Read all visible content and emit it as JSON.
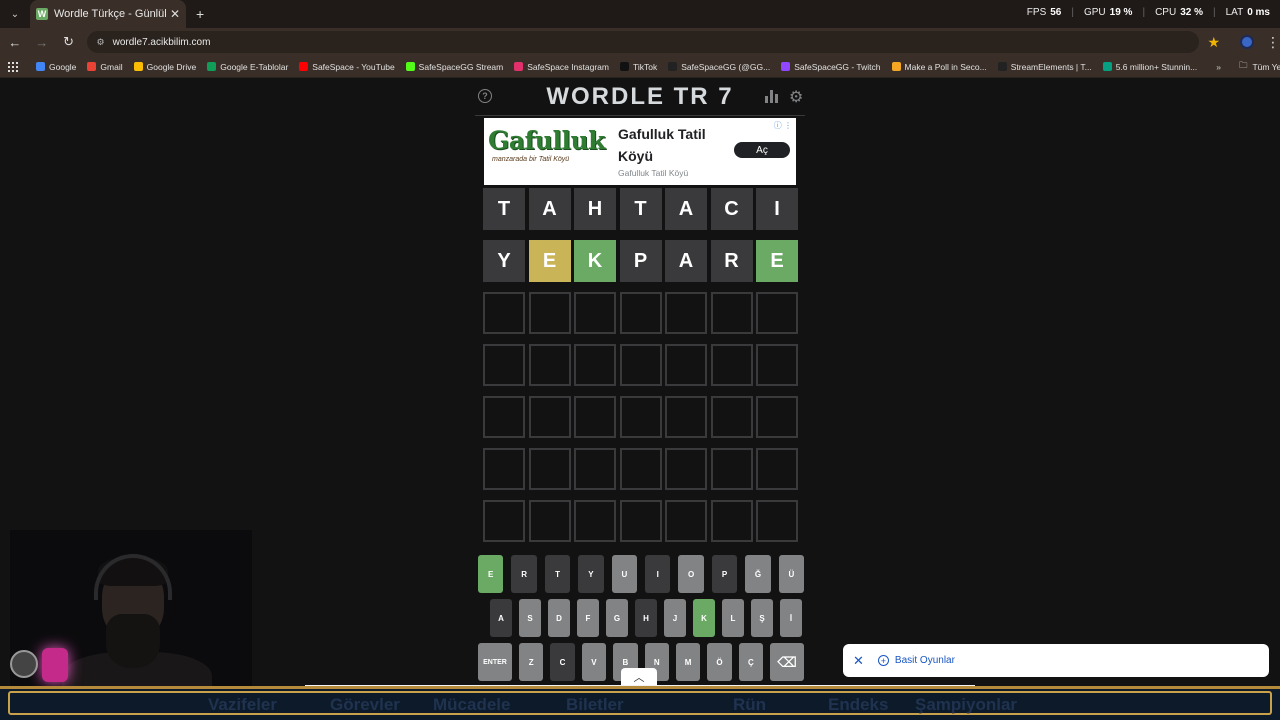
{
  "browser": {
    "tab_title": "Wordle Türkçe - Günlük Kelime",
    "tab_favicon": "W",
    "url": "wordle7.acikbilim.com",
    "overlay": {
      "fps_label": "FPS",
      "fps_value": "56",
      "gpu_label": "GPU",
      "gpu_value": "19 %",
      "cpu_label": "CPU",
      "cpu_value": "32 %",
      "lat_label": "LAT",
      "lat_value": "0 ms"
    },
    "bookmarks": [
      {
        "label": "Google",
        "color": "#4285f4"
      },
      {
        "label": "Gmail",
        "color": "#ea4335"
      },
      {
        "label": "Google Drive",
        "color": "#fbbc04"
      },
      {
        "label": "Google E-Tablolar",
        "color": "#0f9d58"
      },
      {
        "label": "SafeSpace - YouTube",
        "color": "#ff0000"
      },
      {
        "label": "SafeSpaceGG Stream",
        "color": "#53fc18"
      },
      {
        "label": "SafeSpace Instagram",
        "color": "#e1306c"
      },
      {
        "label": "TikTok",
        "color": "#111111"
      },
      {
        "label": "SafeSpaceGG (@GG...",
        "color": "#222222"
      },
      {
        "label": "SafeSpaceGG - Twitch",
        "color": "#9146ff"
      },
      {
        "label": "Make a Poll in Seco...",
        "color": "#f5a623"
      },
      {
        "label": "StreamElements | T...",
        "color": "#222222"
      },
      {
        "label": "5.6 million+ Stunnin...",
        "color": "#05a081"
      }
    ],
    "bookmarks_more": "»",
    "bookmarks_folder": "Tüm Yer İşaretleri"
  },
  "game": {
    "title": "WORDLE TR 7",
    "board": [
      [
        {
          "l": "T",
          "s": "absent"
        },
        {
          "l": "A",
          "s": "absent"
        },
        {
          "l": "H",
          "s": "absent"
        },
        {
          "l": "T",
          "s": "absent"
        },
        {
          "l": "A",
          "s": "absent"
        },
        {
          "l": "C",
          "s": "absent"
        },
        {
          "l": "I",
          "s": "absent"
        }
      ],
      [
        {
          "l": "Y",
          "s": "absent"
        },
        {
          "l": "E",
          "s": "present"
        },
        {
          "l": "K",
          "s": "correct"
        },
        {
          "l": "P",
          "s": "absent"
        },
        {
          "l": "A",
          "s": "absent"
        },
        {
          "l": "R",
          "s": "absent"
        },
        {
          "l": "E",
          "s": "correct"
        }
      ],
      [
        {
          "l": "",
          "s": "empty"
        },
        {
          "l": "",
          "s": "empty"
        },
        {
          "l": "",
          "s": "empty"
        },
        {
          "l": "",
          "s": "empty"
        },
        {
          "l": "",
          "s": "empty"
        },
        {
          "l": "",
          "s": "empty"
        },
        {
          "l": "",
          "s": "empty"
        }
      ],
      [
        {
          "l": "",
          "s": "empty"
        },
        {
          "l": "",
          "s": "empty"
        },
        {
          "l": "",
          "s": "empty"
        },
        {
          "l": "",
          "s": "empty"
        },
        {
          "l": "",
          "s": "empty"
        },
        {
          "l": "",
          "s": "empty"
        },
        {
          "l": "",
          "s": "empty"
        }
      ],
      [
        {
          "l": "",
          "s": "empty"
        },
        {
          "l": "",
          "s": "empty"
        },
        {
          "l": "",
          "s": "empty"
        },
        {
          "l": "",
          "s": "empty"
        },
        {
          "l": "",
          "s": "empty"
        },
        {
          "l": "",
          "s": "empty"
        },
        {
          "l": "",
          "s": "empty"
        }
      ],
      [
        {
          "l": "",
          "s": "empty"
        },
        {
          "l": "",
          "s": "empty"
        },
        {
          "l": "",
          "s": "empty"
        },
        {
          "l": "",
          "s": "empty"
        },
        {
          "l": "",
          "s": "empty"
        },
        {
          "l": "",
          "s": "empty"
        },
        {
          "l": "",
          "s": "empty"
        }
      ],
      [
        {
          "l": "",
          "s": "empty"
        },
        {
          "l": "",
          "s": "empty"
        },
        {
          "l": "",
          "s": "empty"
        },
        {
          "l": "",
          "s": "empty"
        },
        {
          "l": "",
          "s": "empty"
        },
        {
          "l": "",
          "s": "empty"
        },
        {
          "l": "",
          "s": "empty"
        }
      ]
    ],
    "keyboard": [
      [
        {
          "k": "E",
          "s": "correct"
        },
        {
          "k": "R",
          "s": "absent"
        },
        {
          "k": "T",
          "s": "absent"
        },
        {
          "k": "Y",
          "s": "absent"
        },
        {
          "k": "U",
          "s": "light"
        },
        {
          "k": "I",
          "s": "absent"
        },
        {
          "k": "O",
          "s": "light"
        },
        {
          "k": "P",
          "s": "absent"
        },
        {
          "k": "Ğ",
          "s": "light"
        },
        {
          "k": "Ü",
          "s": "light"
        }
      ],
      [
        {
          "k": "A",
          "s": "absent"
        },
        {
          "k": "S",
          "s": "light"
        },
        {
          "k": "D",
          "s": "light"
        },
        {
          "k": "F",
          "s": "light"
        },
        {
          "k": "G",
          "s": "light"
        },
        {
          "k": "H",
          "s": "absent"
        },
        {
          "k": "J",
          "s": "light"
        },
        {
          "k": "K",
          "s": "correct"
        },
        {
          "k": "L",
          "s": "light"
        },
        {
          "k": "Ş",
          "s": "light"
        },
        {
          "k": "İ",
          "s": "light"
        }
      ],
      [
        {
          "k": "ENTER",
          "s": "light",
          "w": "wide"
        },
        {
          "k": "Z",
          "s": "light"
        },
        {
          "k": "C",
          "s": "absent"
        },
        {
          "k": "V",
          "s": "light"
        },
        {
          "k": "B",
          "s": "light"
        },
        {
          "k": "N",
          "s": "light"
        },
        {
          "k": "M",
          "s": "light"
        },
        {
          "k": "Ö",
          "s": "light"
        },
        {
          "k": "Ç",
          "s": "light"
        },
        {
          "k": "⌫",
          "s": "light",
          "w": "back"
        }
      ]
    ]
  },
  "ad": {
    "brand": "Gafulluk",
    "tagline": "manzarada bir Tatil Köyü",
    "title": "Gafulluk Tatil Köyü",
    "subtitle": "Gafulluk Tatil Köyü",
    "button": "Aç",
    "info": "ⓘ ⋮"
  },
  "notification": {
    "close": "✕",
    "label": "Basit Oyunlar"
  },
  "stream_menu": [
    "Vazifeler",
    "Görevler",
    "Mücadele",
    "Biletler",
    "Rün",
    "Endeks",
    "Şampiyonlar"
  ]
}
